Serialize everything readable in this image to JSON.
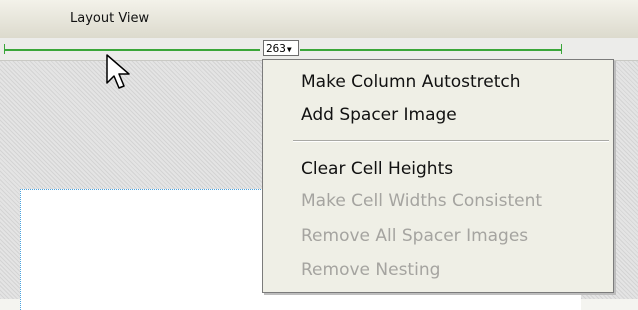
{
  "header": {
    "title": "Layout View"
  },
  "ruler": {
    "column_width": "263",
    "dropdown_arrow": "▼"
  },
  "cursor": {
    "icon": "arrow-pointer-icon"
  },
  "context_menu": {
    "items": [
      {
        "label": "Make Column Autostretch",
        "enabled": true
      },
      {
        "label": "Add Spacer Image",
        "enabled": true
      },
      {
        "label": "Clear Cell Heights",
        "enabled": true
      },
      {
        "label": "Make Cell Widths Consistent",
        "enabled": false
      },
      {
        "label": "Remove All Spacer Images",
        "enabled": false
      },
      {
        "label": "Remove Nesting",
        "enabled": false
      }
    ]
  },
  "colors": {
    "ruler_green": "#3aa63a",
    "disabled_text": "#a5a4a0",
    "cell_border": "#4aa3df"
  }
}
